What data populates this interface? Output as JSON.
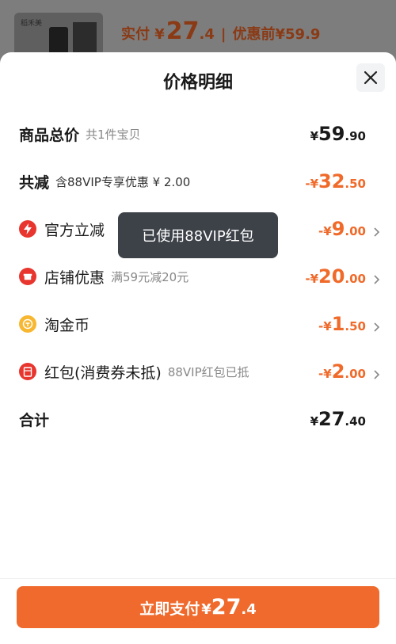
{
  "background": {
    "thumb_brand": "稻禾美",
    "price_prefix": "实付 ¥",
    "price_int": "27",
    "price_dec": ".4",
    "separator": "|",
    "original_label": "优惠前¥59.9"
  },
  "sheet": {
    "title": "价格明细",
    "close_icon": "close-icon"
  },
  "rows": [
    {
      "label": "商品总价",
      "sub": "共1件宝贝",
      "currency": "¥",
      "int": "59",
      "dec": ".90"
    },
    {
      "label": "共减",
      "sub": "含88VIP专享优惠 ¥ 2.00",
      "currency": "-¥",
      "int": "32",
      "dec": ".50"
    },
    {
      "label": "官方立减",
      "icon": "lightning-icon",
      "currency": "-¥",
      "int": "9",
      "dec": ".00"
    },
    {
      "label": "店铺优惠",
      "icon": "shop-icon",
      "sub": "满59元减20元",
      "currency": "-¥",
      "int": "20",
      "dec": ".00"
    },
    {
      "label": "淘金币",
      "icon": "coin-icon",
      "currency": "-¥",
      "int": "1",
      "dec": ".50"
    },
    {
      "label": "红包(消费券未抵)",
      "icon": "red-packet-icon",
      "sub": "88VIP红包已抵",
      "currency": "-¥",
      "int": "2",
      "dec": ".00"
    },
    {
      "label": "合计",
      "currency": "¥",
      "int": "27",
      "dec": ".40"
    }
  ],
  "tooltip": "已使用88VIP红包",
  "pay_button": {
    "label": "立即支付",
    "currency": "¥",
    "int": "27",
    "dec": ".4"
  },
  "colors": {
    "accent": "#ef6a2c",
    "amount_orange": "#f06a2a",
    "tooltip_bg": "#3d4249"
  }
}
